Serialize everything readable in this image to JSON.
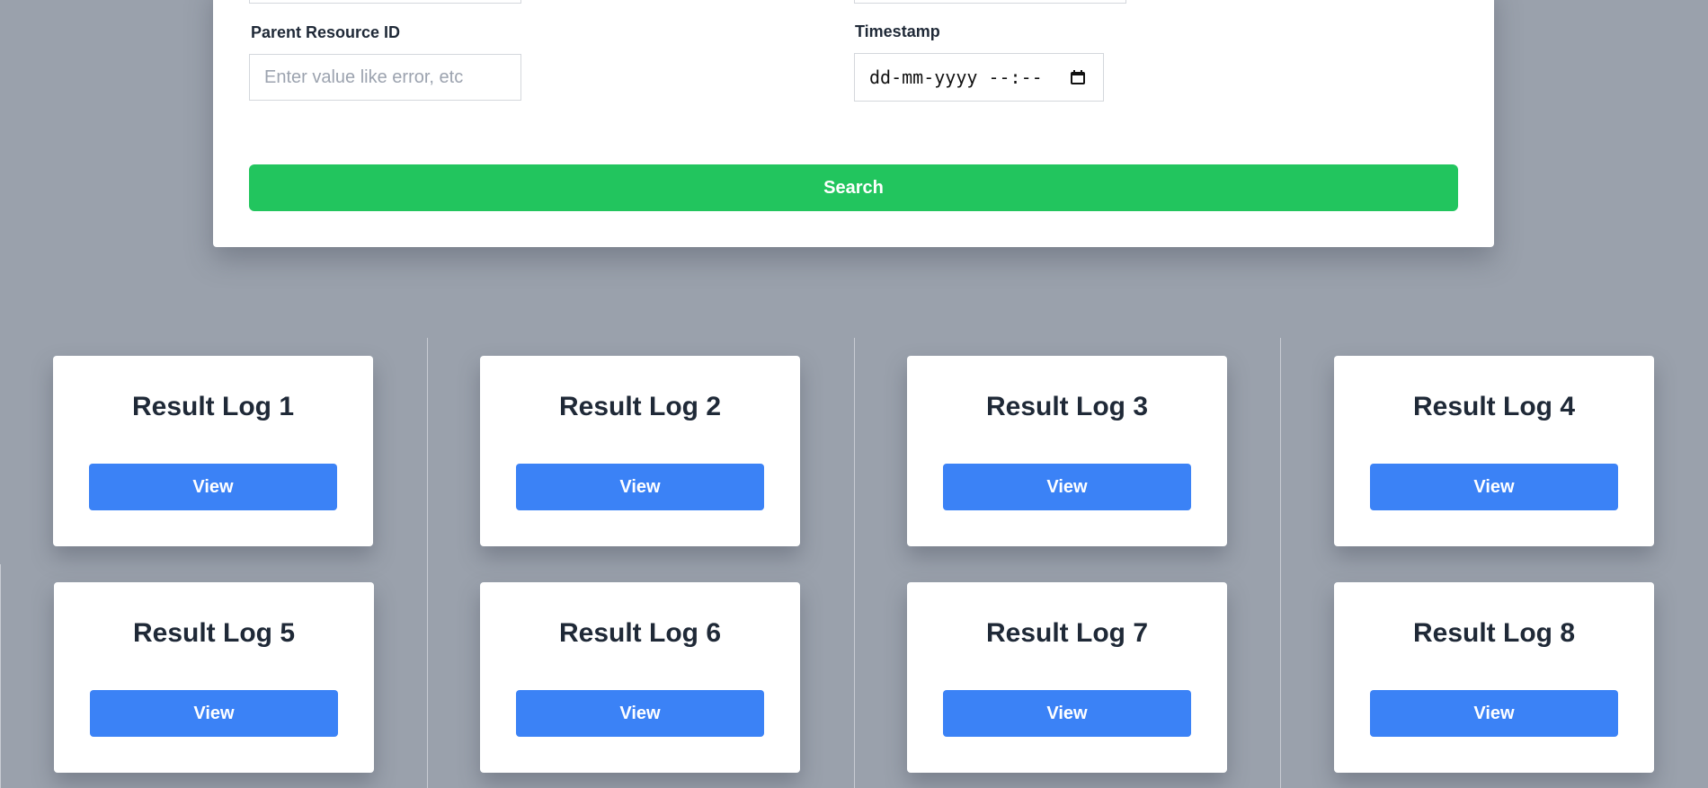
{
  "search_form": {
    "parent_resource_label": "Parent Resource ID",
    "parent_resource_placeholder": "Enter value like error, etc",
    "timestamp_label": "Timestamp",
    "timestamp_value": "dd-mm-yyyy --:--",
    "search_label": "Search"
  },
  "results": [
    {
      "title": "Result Log 1",
      "button": "View"
    },
    {
      "title": "Result Log 2",
      "button": "View"
    },
    {
      "title": "Result Log 3",
      "button": "View"
    },
    {
      "title": "Result Log 4",
      "button": "View"
    },
    {
      "title": "Result Log 5",
      "button": "View"
    },
    {
      "title": "Result Log 6",
      "button": "View"
    },
    {
      "title": "Result Log 7",
      "button": "View"
    },
    {
      "title": "Result Log 8",
      "button": "View"
    }
  ],
  "colors": {
    "background": "#9aa1ac",
    "search_button": "#22c55e",
    "view_button": "#3b82f6"
  },
  "icons": {
    "timestamp_picker": "calendar-icon"
  }
}
